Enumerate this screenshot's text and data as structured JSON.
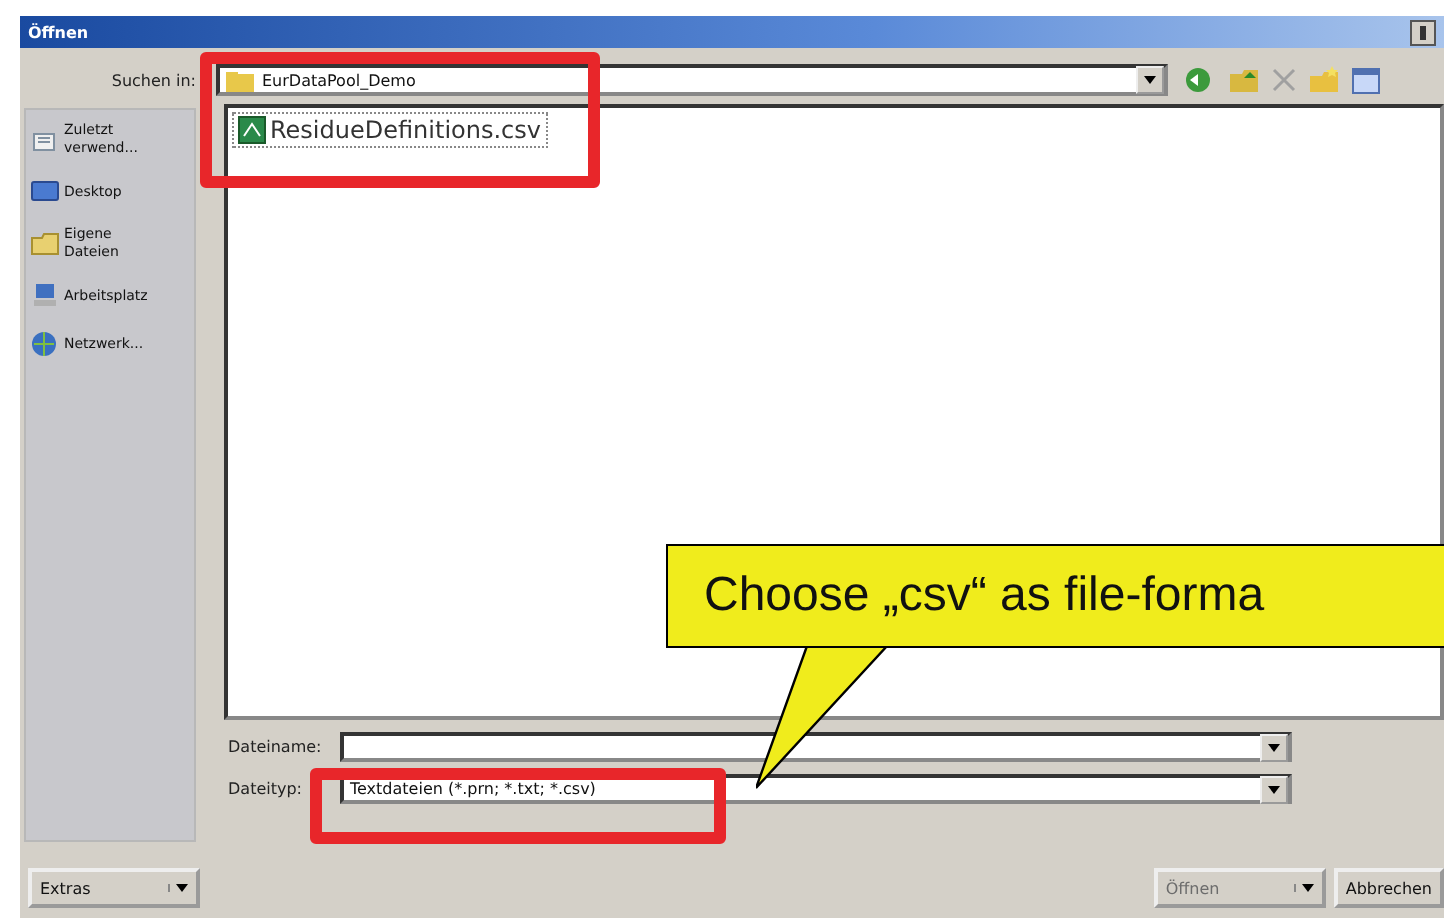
{
  "window": {
    "title": "Öffnen"
  },
  "look_in": {
    "label": "Suchen in:",
    "value": "EurDataPool_Demo"
  },
  "places": [
    {
      "label": "Zuletzt verwend...",
      "kind": "recent"
    },
    {
      "label": "Desktop",
      "kind": "desktop"
    },
    {
      "label": "Eigene Dateien",
      "kind": "documents"
    },
    {
      "label": "Arbeitsplatz",
      "kind": "computer"
    },
    {
      "label": "Netzwerk...",
      "kind": "network"
    }
  ],
  "files": [
    {
      "name": "ResidueDefinitions.csv",
      "selected": false
    }
  ],
  "file_name": {
    "label": "Dateiname:"
  },
  "file_type": {
    "label": "Dateityp:",
    "value": "Textdateien (*.prn; *.txt; *.csv)"
  },
  "buttons": [
    {
      "label": "Extras",
      "kind": "menu",
      "disabled": false
    },
    {
      "label": "Öffnen",
      "kind": "menu",
      "disabled": true
    },
    {
      "label": "Abbrechen",
      "kind": "plain",
      "disabled": false
    }
  ],
  "callout": {
    "text": "Choose „csv“ as file-forma"
  }
}
